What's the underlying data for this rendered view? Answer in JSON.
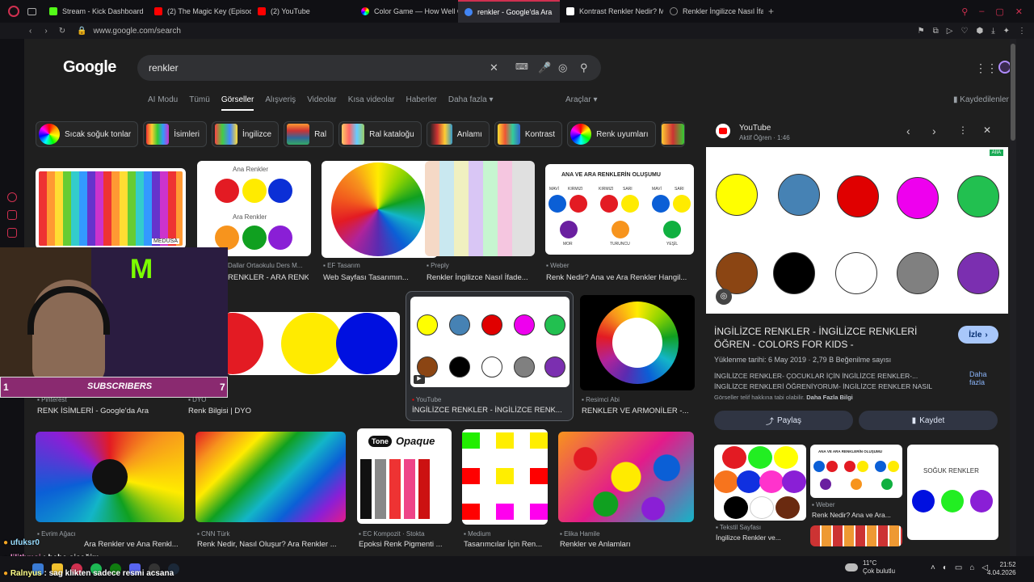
{
  "tabs": [
    {
      "label": "Stream - Kick Dashboard",
      "color": "#53fc18"
    },
    {
      "label": "(2) The Magic Key (Episod",
      "color": "#ff0000"
    },
    {
      "label": "(2) YouTube",
      "color": "#ff0000"
    },
    {
      "label": "Color Game — How Well C",
      "color": "#e040fb"
    },
    {
      "label": "renkler - Google'da Ara",
      "color": "#4285f4"
    },
    {
      "label": "Kontrast Renkler Nedir? M",
      "color": "#ffffff"
    },
    {
      "label": "Renkler İngilizce Nasıl İfade",
      "color": "#888888"
    }
  ],
  "address": {
    "url": "www.google.com/search"
  },
  "google": {
    "logo": "Google",
    "query": "renkler"
  },
  "nav": {
    "items": [
      "AI Modu",
      "Tümü",
      "Görseller",
      "Alışveriş",
      "Videolar",
      "Kısa videolar",
      "Haberler",
      "Daha fazla"
    ],
    "tools": "Araçlar",
    "saved": "Kaydedilenler"
  },
  "chips": [
    "Sıcak soğuk tonlar",
    "İsimleri",
    "İngilizce",
    "Ral",
    "Ral kataloğu",
    "Anlamı",
    "Kontrast",
    "Renk uyumları"
  ],
  "row1": [
    {
      "source": "",
      "title": ""
    },
    {
      "source": "Dallar Ortaokulu Ders M...",
      "title": "RENKLER - ARA RENK..."
    },
    {
      "source": "EF Tasarım",
      "title": "Web Sayfası Tasarımın..."
    },
    {
      "source": "Preply",
      "title": "Renkler İngilizce Nasıl İfade..."
    },
    {
      "source": "Weber",
      "title": "Renk Nedir? Ana ve Ara Renkler Hangil..."
    }
  ],
  "ana_renkler": {
    "top": "Ana Renkler",
    "bottom": "Ara Renkler"
  },
  "medusa": "MEDUSA",
  "ana_ara": {
    "title": "ANA VE ARA RENKLERİN OLUŞUMU",
    "labels": [
      "MAVİ",
      "KIRMIZI",
      "KIRMIZI",
      "SARI",
      "MAVİ",
      "SARI"
    ],
    "results": [
      "MOR",
      "TURUNCU",
      "YEŞİL"
    ]
  },
  "row2": [
    {
      "source": "Pinterest",
      "title": "RENK İSİMLERİ - Google'da Ara"
    },
    {
      "source": "DYO",
      "title": "Renk Bilgisi | DYO"
    },
    {
      "source": "YouTube",
      "title": "İNGİLİZCE RENKLER - İNGİLİZCE RENK..."
    },
    {
      "source": "Resimci Abi",
      "title": "RENKLER VE ARMONİLER -..."
    }
  ],
  "row3": [
    {
      "source": "Evrim Ağacı",
      "title": "Ara Renkler ve Ana Renkl..."
    },
    {
      "source": "CNN Türk",
      "title": "Renk Nedir, Nasıl Oluşur? Ara Renkler ..."
    },
    {
      "source": "EC Kompozit · Stokta",
      "title": "Epoksi Renk Pigmenti ..."
    },
    {
      "source": "Medium",
      "title": "Tasarımcılar İçin Ren..."
    },
    {
      "source": "Elika Hamile",
      "title": "Renkler ve Anlamları"
    }
  ],
  "tone_opaque": {
    "tone": "Tone",
    "opaque": "Opaque"
  },
  "panel": {
    "source": "YouTube",
    "channel": "Aktif Öğren · 1:46",
    "title": "İNGİLİZCE RENKLER - İNGİLİZCE RENKLERİ ÖĞREN - COLORS FOR KIDS -",
    "watch": "İzle",
    "meta": "Yüklenme tarihi: 6 May 2019 · 2,79 B Beğenilme sayısı",
    "desc1": "İNGİLİZCE RENKLER- ÇOCUKLAR İÇİN İNGİLİZCE RENKLER-...",
    "desc2": "İNGİLİZCE RENKLERİ ÖĞRENİYORUM- İNGİLİZCE RENKLER NASIL",
    "copyright": "Görseller telif hakkına tabi olabilir.",
    "more_info": "Daha Fazla Bilgi",
    "more": "Daha fazla",
    "share": "Paylaş",
    "save": "Kaydet",
    "badge": "AIIA",
    "related": [
      {
        "source": "Tekstil Sayfası",
        "title": "İngilizce Renkler ve..."
      },
      {
        "source": "Weber",
        "title": "Renk Nedir? Ana ve Ara..."
      },
      {
        "source": "",
        "title": ""
      }
    ],
    "cold": "SOĞUK RENKLER"
  },
  "stream": {
    "subs_label": "SUBSCRIBERS",
    "subs_left": "1",
    "subs_right": "7"
  },
  "chat": [
    {
      "user": "ufuksr0",
      "msg": ""
    },
    {
      "user": "lilithmsi",
      "msg": "hebe çiçeğim"
    },
    {
      "user": "Ralnyus",
      "msg": "sag klikten sadece resmi acsana"
    }
  ],
  "system": {
    "weather": "11°C",
    "weather_desc": "Çok bulutlu",
    "time": "21:52",
    "date": "4.04.2026"
  },
  "colors": {
    "accent": "#d03050",
    "watch_btn": "#a8c7fa"
  }
}
